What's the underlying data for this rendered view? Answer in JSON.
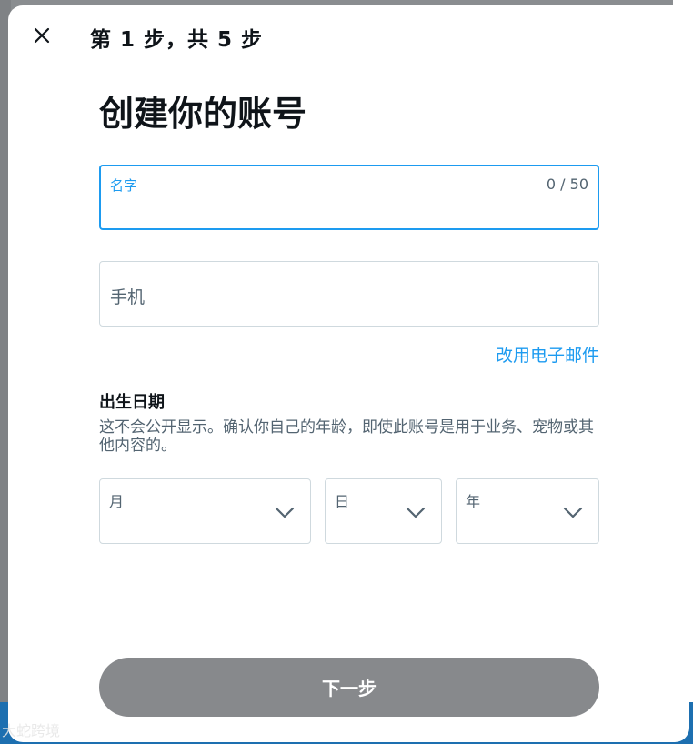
{
  "header": {
    "close_icon": "close-icon",
    "step_text": "第 1 步，共 5 步"
  },
  "main": {
    "title": "创建你的账号",
    "name_field": {
      "label": "名字",
      "value": "",
      "counter": "0 / 50"
    },
    "phone_field": {
      "placeholder": "手机",
      "value": ""
    },
    "switch_link": "改用电子邮件",
    "dob": {
      "title": "出生日期",
      "description": "这不会公开显示。确认你自己的年龄，即使此账号是用于业务、宠物或其他内容的。",
      "month_label": "月",
      "day_label": "日",
      "year_label": "年"
    },
    "next_button": "下一步"
  },
  "watermark": "大蛇跨境",
  "colors": {
    "accent": "#1d9bf0",
    "button_disabled": "#87898c",
    "text_primary": "#0f1419",
    "text_secondary": "#536471",
    "border": "#cfd9de"
  }
}
